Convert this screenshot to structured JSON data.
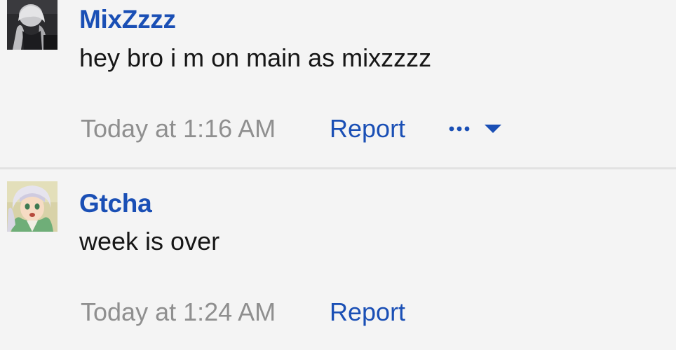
{
  "messages": [
    {
      "username": "MixZzzz",
      "text": "hey bro i m on main as mixzzzz",
      "timestamp": "Today at 1:16 AM",
      "report_label": "Report",
      "has_more_menu": true
    },
    {
      "username": "Gtcha",
      "text": "week is over",
      "timestamp": "Today at 1:24 AM",
      "report_label": "Report",
      "has_more_menu": false
    }
  ],
  "colors": {
    "link": "#1a4fb5",
    "muted": "#8f8f8f",
    "text": "#161616",
    "background": "#f4f4f4",
    "divider": "#e2e2e2"
  },
  "icons": {
    "more_menu": "ellipsis-caret-icon"
  }
}
